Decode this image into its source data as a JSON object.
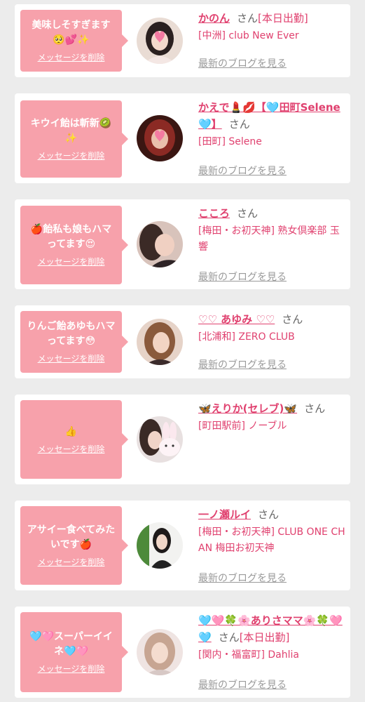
{
  "cards": [
    {
      "message": "美味しそすぎます🥺💕✨",
      "delete_label": "メッセージを削除",
      "name": "かのん",
      "honorific": "さん",
      "status": "[本日出勤]",
      "shop": "[中洲] club New Ever",
      "blog_link": "最新のブログを見る",
      "avatar": "avatar-photo-heart"
    },
    {
      "message": "キウイ飴は斬新🥝✨",
      "delete_label": "メッセージを削除",
      "name": "かえで💄💋【🩵田町Selene🩵】",
      "honorific": "さん",
      "status": "",
      "shop": "[田町] Selene",
      "blog_link": "最新のブログを見る",
      "avatar": "avatar-photo-heart"
    },
    {
      "message": "🍎飴私も娘もハマってます😍",
      "delete_label": "メッセージを削除",
      "name": "こころ",
      "honorific": "さん",
      "status": "",
      "shop": "[梅田・お初天神] 熟女倶楽部 玉響",
      "blog_link": "最新のブログを見る",
      "avatar": "avatar-photo"
    },
    {
      "message": "りんご飴あゆもハマってます😳",
      "delete_label": "メッセージを削除",
      "name": "♡♡ あゆみ ♡♡",
      "honorific": "さん",
      "status": "",
      "shop": "[北浦和] ZERO CLUB",
      "blog_link": "最新のブログを見る",
      "avatar": "avatar-photo"
    },
    {
      "message": "👍",
      "delete_label": "メッセージを削除",
      "name": "🦋えりか(セレブ)🦋",
      "honorific": "さん",
      "status": "",
      "shop": "[町田駅前] ノーブル",
      "blog_link": "",
      "avatar": "avatar-photo-bunny"
    },
    {
      "message": "アサイー食べてみたいです🍎",
      "delete_label": "メッセージを削除",
      "name": "一ノ瀬ルイ",
      "honorific": "さん",
      "status": "",
      "shop": "[梅田・お初天神] CLUB ONE CHAN 梅田お初天神",
      "blog_link": "最新のブログを見る",
      "avatar": "avatar-photo"
    },
    {
      "message": "🩵🩷スーパーイイネ🩵🩷",
      "delete_label": "メッセージを削除",
      "name": "🩵🩷🍀🌸ありさママ🌸🍀🩷🩵",
      "honorific": "さん",
      "status": "[本日出勤]",
      "shop": "[関内・福富町] Dahlia",
      "blog_link": "最新のブログを見る",
      "avatar": "avatar-photo"
    }
  ],
  "colors": {
    "accent_pink": "#e0416f",
    "bubble_pink": "#f7a1ab",
    "background": "#ececec"
  }
}
